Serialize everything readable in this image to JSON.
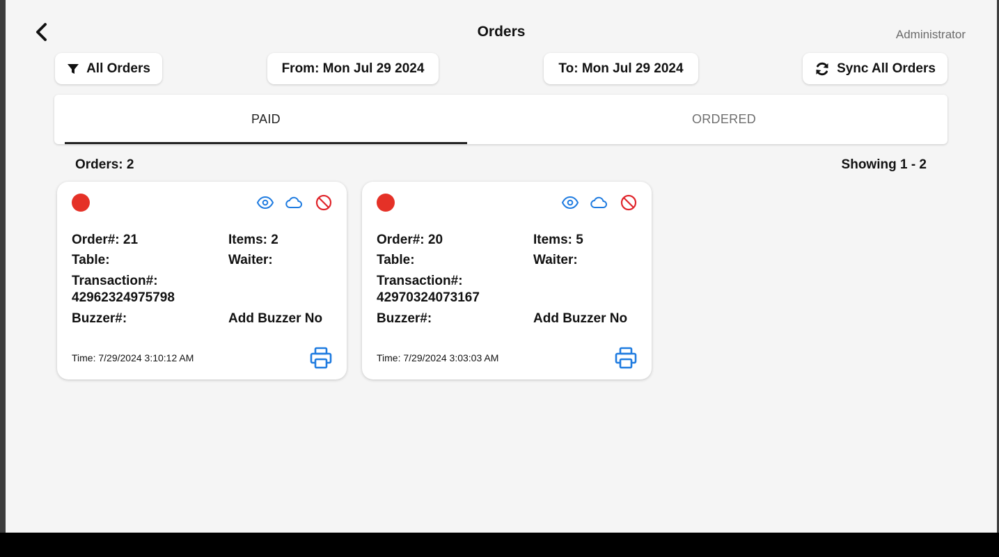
{
  "header": {
    "title": "Orders",
    "user": "Administrator"
  },
  "toolbar": {
    "filter_label": "All Orders",
    "from_label": "From: Mon Jul 29 2024",
    "to_label": "To: Mon Jul 29 2024",
    "sync_label": "Sync All Orders"
  },
  "tabs": [
    {
      "label": "PAID",
      "active": true
    },
    {
      "label": "ORDERED",
      "active": false
    }
  ],
  "summary": {
    "count": "Orders: 2",
    "range": "Showing 1 - 2"
  },
  "colors": {
    "status_red": "#e53127",
    "icon_blue": "#1e7be0",
    "icon_red": "#e0242a"
  },
  "orders": [
    {
      "order": "Order#: 21",
      "items": "Items: 2",
      "table": "Table:",
      "waiter": "Waiter:",
      "transaction_label": "Transaction#:",
      "transaction": "42962324975798",
      "buzzer": "Buzzer#:",
      "add_buzzer": "Add Buzzer No",
      "time": "Time: 7/29/2024 3:10:12 AM"
    },
    {
      "order": "Order#: 20",
      "items": "Items: 5",
      "table": "Table:",
      "waiter": "Waiter:",
      "transaction_label": "Transaction#:",
      "transaction": "42970324073167",
      "buzzer": "Buzzer#:",
      "add_buzzer": "Add Buzzer No",
      "time": "Time: 7/29/2024 3:03:03 AM"
    }
  ]
}
